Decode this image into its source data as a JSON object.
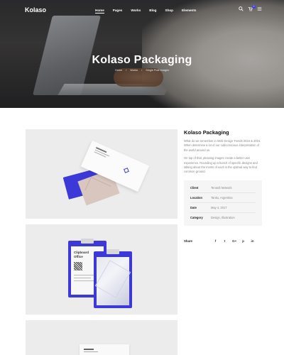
{
  "nav": {
    "logo": "Kolaso",
    "menu": [
      "Home",
      "Pages",
      "Works",
      "Blog",
      "Shop",
      "Elements"
    ],
    "active_index": 0,
    "icons": [
      "search-icon",
      "cart-icon",
      "menu-icon"
    ],
    "cart_count": "0"
  },
  "hero": {
    "title": "Kolaso Packaging",
    "breadcrumb": [
      "Home",
      "/",
      "Works",
      "/",
      "Single Post Images"
    ]
  },
  "project": {
    "title": "Kolaso Packaging",
    "description_1": "What do we remember in Web Design Trends 2015 & 2016. When determine a lot of our subconscious interpretation of the world around us.",
    "description_2": "On top of that, pleasing images create a better user experience. Rounding up a bunch of specific designs and talking about the merits of each is the optimal way to find common ground."
  },
  "info": {
    "rows": [
      {
        "label": "Client",
        "value": "Tenardi Network"
      },
      {
        "label": "Location",
        "value": "Tanitu, Argentina"
      },
      {
        "label": "Date",
        "value": "May 4, 2017"
      },
      {
        "label": "Category",
        "value": "Design, Illustration"
      }
    ]
  },
  "share": {
    "label": "Share",
    "icons": [
      {
        "name": "facebook-icon",
        "glyph": "f"
      },
      {
        "name": "twitter-icon",
        "glyph": "t"
      },
      {
        "name": "google-plus-icon",
        "glyph": "G+"
      },
      {
        "name": "pinterest-icon",
        "glyph": "p"
      },
      {
        "name": "linkedin-icon",
        "glyph": "in"
      }
    ]
  },
  "gallery": {
    "clipboard_title_1": "Clipboard",
    "clipboard_title_2": "Office"
  },
  "colors": {
    "accent": "#3d39d8",
    "hero_overlay": "#2c2c2e",
    "info_box_bg": "#f5f5f5"
  }
}
